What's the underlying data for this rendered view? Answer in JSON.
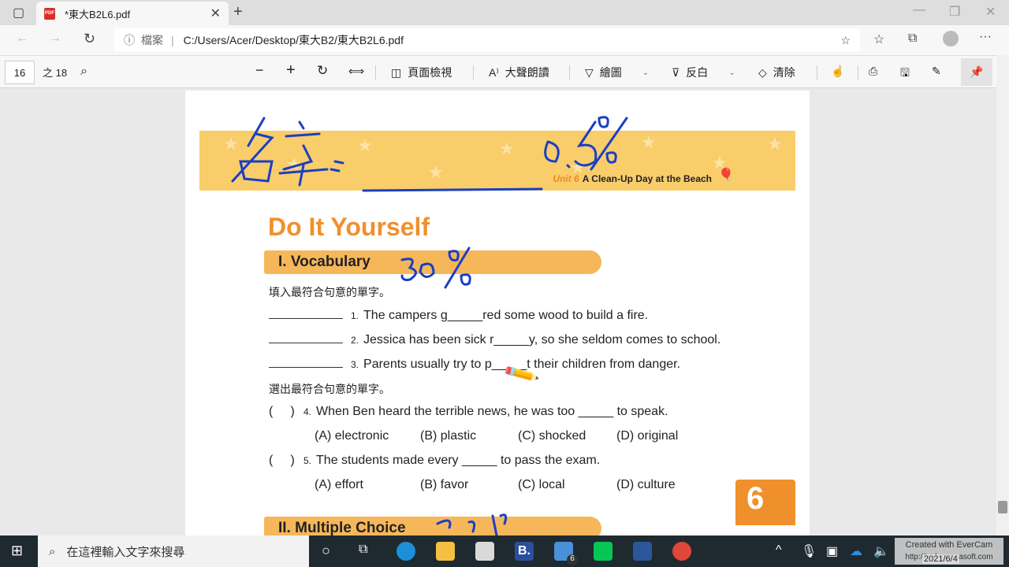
{
  "browser": {
    "tab_title": "*東大B2L6.pdf",
    "url_label": "檔案",
    "url": "C:/Users/Acer/Desktop/東大B2/東大B2L6.pdf"
  },
  "pdf_toolbar": {
    "page": "16",
    "of_total": "之 18",
    "page_view": "頁面檢視",
    "read_aloud": "大聲朗讀",
    "draw": "繪圖",
    "highlight": "反白",
    "erase": "清除"
  },
  "document": {
    "banner": {
      "unit": "Unit 6",
      "title": "A Clean-Up Day at the Beach"
    },
    "heading": "Do It Yourself",
    "section1": "I. Vocabulary",
    "inst1": "填入最符合句意的單字。",
    "fill": [
      {
        "n": "1.",
        "text": "The campers g_____red some wood to build a fire."
      },
      {
        "n": "2.",
        "text": "Jessica has been sick r_____y, so she seldom comes to school."
      },
      {
        "n": "3.",
        "text": "Parents usually try to p_____t their children from danger."
      }
    ],
    "inst2": "選出最符合句意的單字。",
    "choice": [
      {
        "n": "4.",
        "text": "When Ben heard the terrible news, he was too _____ to speak.",
        "options": [
          "(A) electronic",
          "(B) plastic",
          "(C) shocked",
          "(D) original"
        ]
      },
      {
        "n": "5.",
        "text": "The students made every _____ to pass the exam.",
        "options": [
          "(A) effort",
          "(B) favor",
          "(C) local",
          "(D) culture"
        ]
      }
    ],
    "page_number": "6",
    "section2": "II. Multiple Choice"
  },
  "taskbar": {
    "search_placeholder": "在這裡輸入文字來搜尋",
    "mail_badge": "6",
    "watermark_line1": "Created with EverCam",
    "watermark_line2": "http://tw.formosasoft.com",
    "date": "2021/6/4"
  },
  "colors": {
    "banner": "#f9cd6a",
    "accent": "#f0902c",
    "ink": "#1a3fc4"
  }
}
